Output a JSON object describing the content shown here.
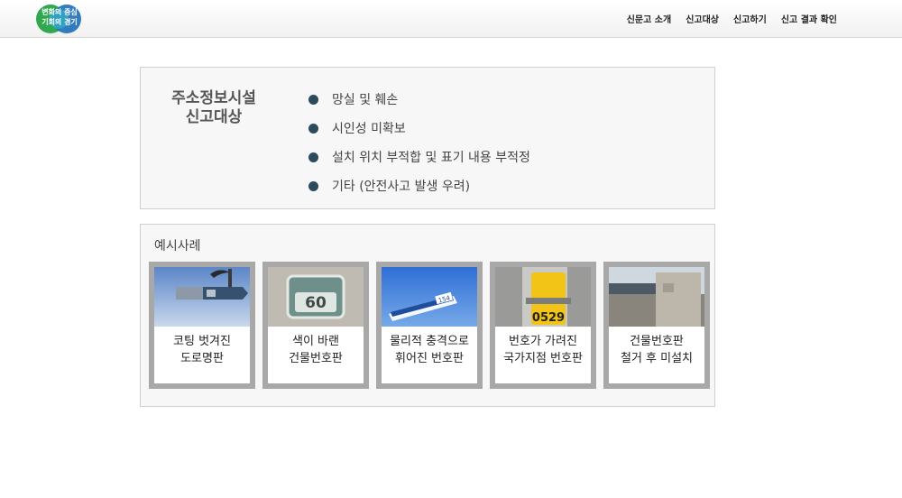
{
  "header": {
    "logo": {
      "line1": "변화의 중심",
      "line2": "기회의 경기"
    },
    "nav": [
      "신문고 소개",
      "신고대상",
      "신고하기",
      "신고 결과 확인"
    ]
  },
  "criteria_box": {
    "title_line1": "주소정보시설",
    "title_line2": "신고대상",
    "items": [
      "망실 및 훼손",
      "시인성 미확보",
      "설치 위치 부적합 및 표기 내용 부적정",
      "기타 (안전사고 발생 우려)"
    ]
  },
  "examples": {
    "title": "예시사례",
    "cards": [
      {
        "line1": "코팅 벗겨진",
        "line2": "도로명판",
        "photo": "peeled-road-sign-photo",
        "sign_text": ""
      },
      {
        "line1": "색이 바랜",
        "line2": "건물번호판",
        "photo": "faded-building-number-photo",
        "sign_text": "60"
      },
      {
        "line1": "물리적 충격으로",
        "line2": "휘어진 번호판",
        "photo": "bent-road-sign-photo",
        "sign_text": "154"
      },
      {
        "line1": "번호가 가려진",
        "line2": "국가지점 번호판",
        "photo": "covered-national-point-sign-photo",
        "sign_text": "0529"
      },
      {
        "line1": "건물번호판",
        "line2": "철거 후 미설치",
        "photo": "missing-building-sign-photo",
        "sign_text": ""
      }
    ]
  },
  "colors": {
    "bullet": "#2b4a5e",
    "card_border": "#a8a8a8",
    "logo_blue": "#1d6fb8",
    "logo_green": "#2fa84f"
  }
}
